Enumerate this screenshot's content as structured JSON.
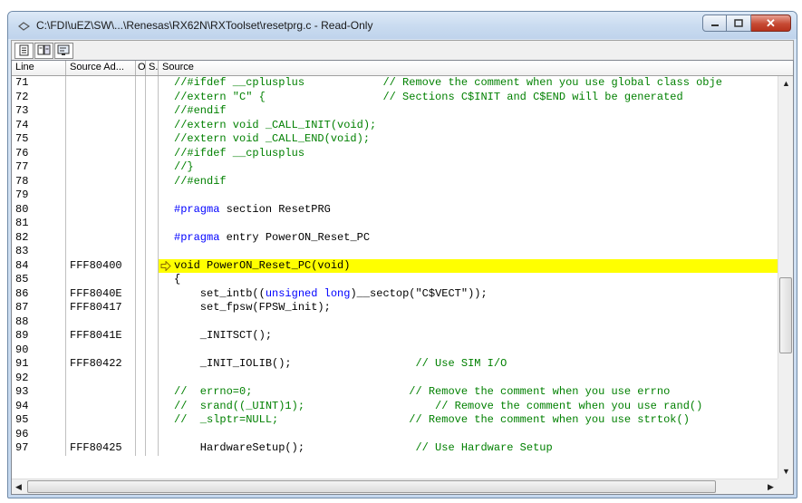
{
  "window": {
    "title": "C:\\FDI\\uEZ\\SW\\...\\Renesas\\RX62N\\RXToolset\\resetprg.c - Read-Only",
    "minimize_icon": "minimize-icon",
    "maximize_icon": "maximize-icon",
    "close_icon": "close-icon",
    "close_symbol": "✕"
  },
  "toolbar": {
    "buttons": [
      {
        "icon": "source-view-icon"
      },
      {
        "icon": "mixed-view-icon"
      },
      {
        "icon": "disassembly-view-icon"
      }
    ]
  },
  "columns": {
    "line": "Line",
    "address": "Source Ad...",
    "o": "O..",
    "s": "S..",
    "source": "Source"
  },
  "colors": {
    "highlight": "#ffff00",
    "keyword": "#0000ff",
    "comment": "#008000",
    "pragma": "#0000ff",
    "string": "#000000"
  },
  "rows": [
    {
      "line": "71",
      "addr": "",
      "code": "//#ifdef __cplusplus            // Remove the comment when you use global class obje",
      "type": "comment"
    },
    {
      "line": "72",
      "addr": "",
      "code": "//extern \"C\" {                  // Sections C$INIT and C$END will be generated",
      "type": "comment"
    },
    {
      "line": "73",
      "addr": "",
      "code": "//#endif",
      "type": "comment"
    },
    {
      "line": "74",
      "addr": "",
      "code": "//extern void _CALL_INIT(void);",
      "type": "comment"
    },
    {
      "line": "75",
      "addr": "",
      "code": "//extern void _CALL_END(void);",
      "type": "comment"
    },
    {
      "line": "76",
      "addr": "",
      "code": "//#ifdef __cplusplus",
      "type": "comment"
    },
    {
      "line": "77",
      "addr": "",
      "code": "//}",
      "type": "comment"
    },
    {
      "line": "78",
      "addr": "",
      "code": "//#endif",
      "type": "comment"
    },
    {
      "line": "79",
      "addr": "",
      "code": "",
      "type": "plain"
    },
    {
      "line": "80",
      "addr": "",
      "code": "#pragma section ResetPRG",
      "type": "pragma",
      "pre": "#pragma",
      "post": " section ResetPRG"
    },
    {
      "line": "81",
      "addr": "",
      "code": "",
      "type": "plain"
    },
    {
      "line": "82",
      "addr": "",
      "code": "#pragma entry PowerON_Reset_PC",
      "type": "pragma",
      "pre": "#pragma",
      "post": " entry PowerON_Reset_PC"
    },
    {
      "line": "83",
      "addr": "",
      "code": "",
      "type": "plain"
    },
    {
      "line": "84",
      "addr": "FFF80400",
      "code": "void PowerON_Reset_PC(void)",
      "type": "highlight"
    },
    {
      "line": "85",
      "addr": "",
      "code": "{",
      "type": "plain"
    },
    {
      "line": "86",
      "addr": "FFF8040E",
      "code": "    set_intb((unsigned long)__sectop(\"C$VECT\"));",
      "type": "kw",
      "pre": "    set_intb((",
      "kw": "unsigned long",
      "post": ")__sectop(\"C$VECT\"));"
    },
    {
      "line": "87",
      "addr": "FFF80417",
      "code": "    set_fpsw(FPSW_init);",
      "type": "plain"
    },
    {
      "line": "88",
      "addr": "",
      "code": "",
      "type": "plain"
    },
    {
      "line": "89",
      "addr": "FFF8041E",
      "code": "    _INITSCT();",
      "type": "plain"
    },
    {
      "line": "90",
      "addr": "",
      "code": "",
      "type": "plain"
    },
    {
      "line": "91",
      "addr": "FFF80422",
      "code": "    _INIT_IOLIB();",
      "type": "tailcomment",
      "pre": "    _INIT_IOLIB();                   ",
      "post": "// Use SIM I/O"
    },
    {
      "line": "92",
      "addr": "",
      "code": "",
      "type": "plain"
    },
    {
      "line": "93",
      "addr": "",
      "code": "//  errno=0;                        // Remove the comment when you use errno",
      "type": "comment"
    },
    {
      "line": "94",
      "addr": "",
      "code": "//  srand((_UINT)1);                    // Remove the comment when you use rand()",
      "type": "comment"
    },
    {
      "line": "95",
      "addr": "",
      "code": "//  _slptr=NULL;                    // Remove the comment when you use strtok()",
      "type": "comment"
    },
    {
      "line": "96",
      "addr": "",
      "code": "",
      "type": "plain"
    },
    {
      "line": "97",
      "addr": "FFF80425",
      "code": "    HardwareSetup();                 // Use Hardware Setup",
      "type": "tailcomment",
      "pre": "    HardwareSetup();                 ",
      "post": "// Use Hardware Setup"
    }
  ],
  "current_line_marker": "arrow-right-icon",
  "scrollbars": {
    "up": "▲",
    "down": "▼",
    "left": "◀",
    "right": "▶"
  }
}
